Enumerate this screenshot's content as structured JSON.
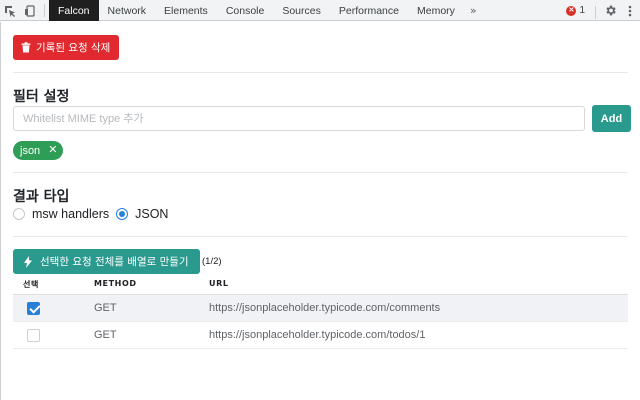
{
  "devtools": {
    "tabs": [
      "Falcon",
      "Network",
      "Elements",
      "Console",
      "Sources",
      "Performance",
      "Memory"
    ],
    "active_tab": "Falcon",
    "more_tabs": "»",
    "error_count": "1"
  },
  "actions": {
    "delete_label": "기록된 요청 삭제",
    "make_array_label": "선택한 요청 전체를 배열로 만들기",
    "selection_count": "(1/2)"
  },
  "filter": {
    "title": "필터 설정",
    "placeholder": "Whitelist MIME type 추가",
    "value": "",
    "add_label": "Add",
    "chips": [
      "json"
    ]
  },
  "result_type": {
    "title": "결과 타입",
    "options": [
      "msw handlers",
      "JSON"
    ],
    "selected": "JSON"
  },
  "table": {
    "headers": [
      "선택",
      "METHOD",
      "URL"
    ],
    "rows": [
      {
        "checked": true,
        "method": "GET",
        "url": "https://jsonplaceholder.typicode.com/comments"
      },
      {
        "checked": false,
        "method": "GET",
        "url": "https://jsonplaceholder.typicode.com/todos/1"
      }
    ]
  },
  "colors": {
    "danger": "#e02a2f",
    "primary": "#2b9a8e",
    "chip": "#2e9e57",
    "radio_checked": "#2680d9"
  }
}
